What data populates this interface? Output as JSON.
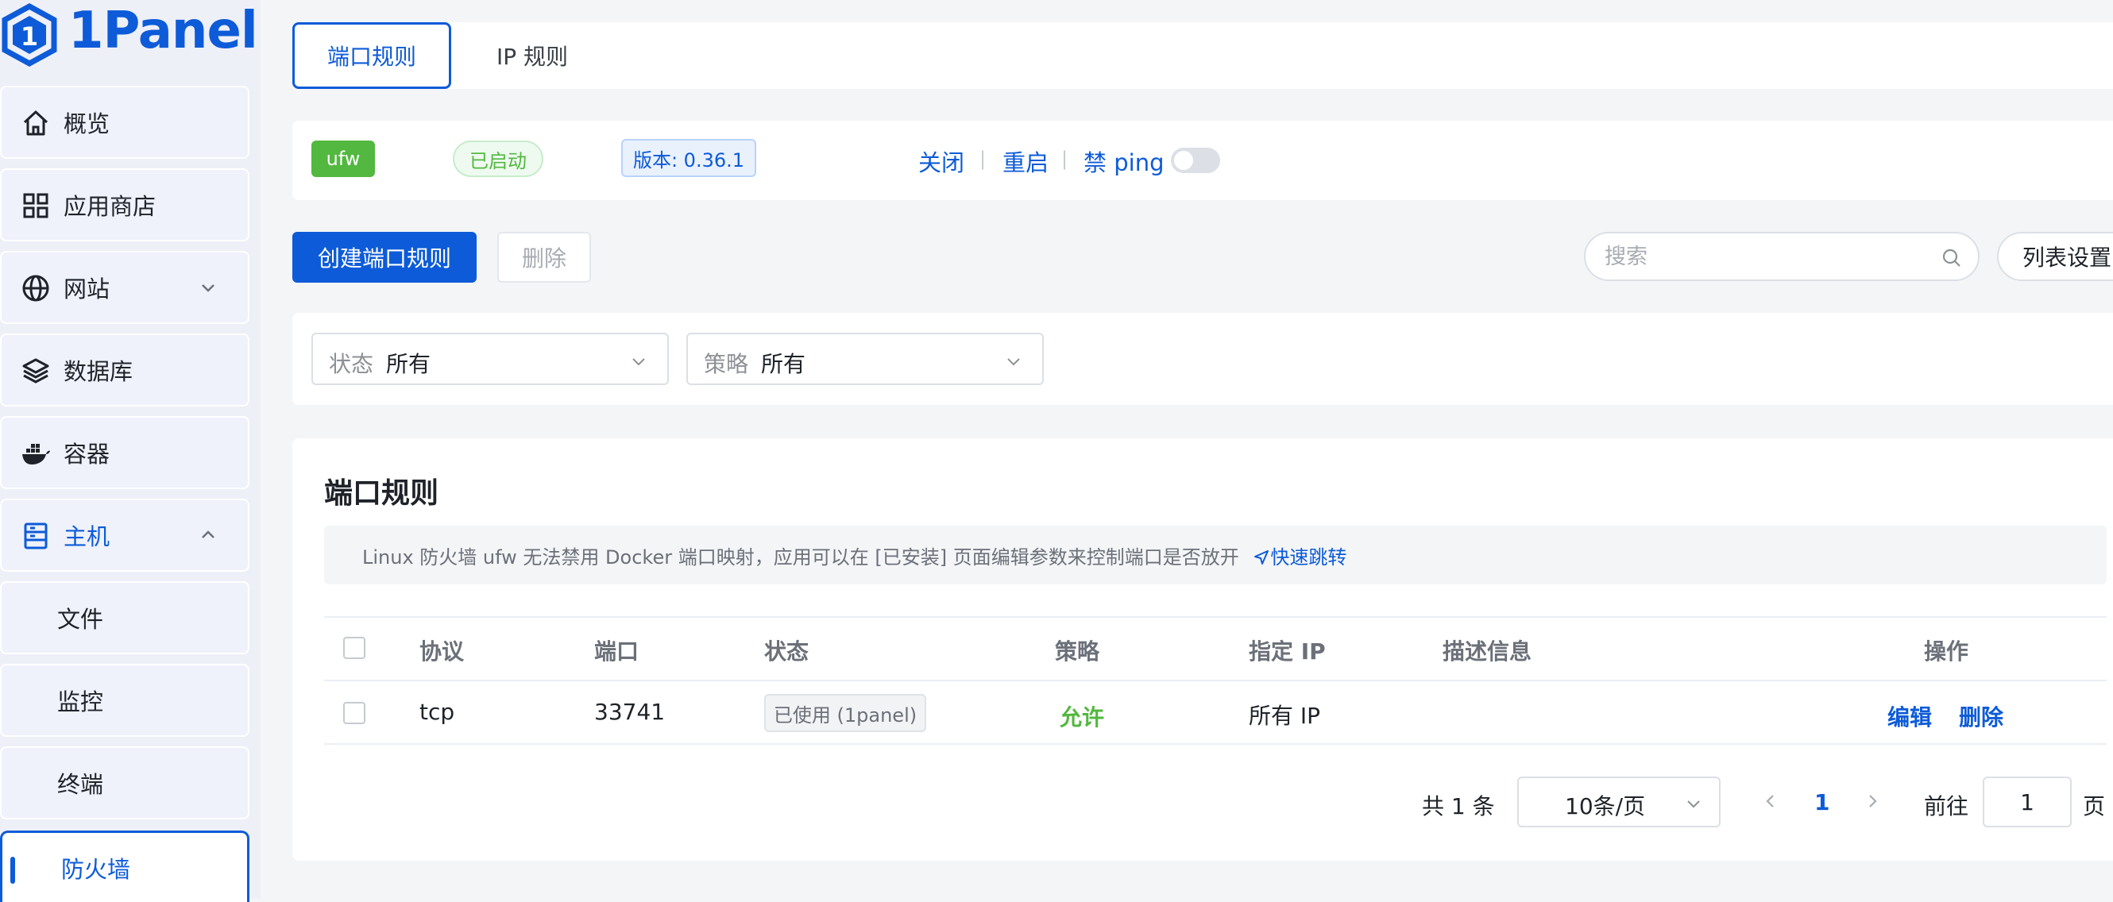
{
  "brand": {
    "name": "1Panel",
    "logo_digit": "1"
  },
  "sidebar": {
    "items": [
      {
        "label": "概览",
        "icon": "home-icon"
      },
      {
        "label": "应用商店",
        "icon": "grid-icon"
      },
      {
        "label": "网站",
        "icon": "globe-icon"
      },
      {
        "label": "数据库",
        "icon": "layers-icon"
      },
      {
        "label": "容器",
        "icon": "docker-icon"
      },
      {
        "label": "主机",
        "icon": "server-icon"
      }
    ],
    "sub_items": [
      {
        "label": "文件"
      },
      {
        "label": "监控"
      },
      {
        "label": "终端"
      },
      {
        "label": "防火墙"
      }
    ]
  },
  "tabs": [
    {
      "label": "端口规则",
      "active": true
    },
    {
      "label": "IP 规则",
      "active": false
    }
  ],
  "status_bar": {
    "engine": "ufw",
    "state": "已启动",
    "version": "版本: 0.36.1",
    "actions": {
      "stop": "关闭",
      "restart": "重启",
      "ban_ping_prefix": "禁",
      "ban_ping_suffix": "ping"
    },
    "ping_banned": false
  },
  "toolbar": {
    "create_label": "创建端口规则",
    "delete_label": "删除",
    "search_placeholder": "搜索",
    "column_settings_label": "列表设置"
  },
  "filters": {
    "status": {
      "prefix": "状态",
      "value": "所有"
    },
    "strategy": {
      "prefix": "策略",
      "value": "所有"
    }
  },
  "section": {
    "title": "端口规则",
    "alert_text": "Linux 防火墙 ufw 无法禁用 Docker 端口映射，应用可以在 [已安装] 页面编辑参数来控制端口是否放开",
    "alert_link": "快速跳转"
  },
  "table": {
    "headers": [
      "协议",
      "端口",
      "状态",
      "策略",
      "指定 IP",
      "描述信息",
      "操作"
    ],
    "rows": [
      {
        "protocol": "tcp",
        "port": "33741",
        "status": "已使用 (1panel)",
        "strategy": "允许",
        "ip": "所有 IP",
        "description": "",
        "edit": "编辑",
        "delete": "删除"
      }
    ]
  },
  "pagination": {
    "total": "共 1 条",
    "page_size": "10条/页",
    "current_page": "1",
    "goto_label": "前往",
    "goto_value": "1",
    "page_suffix": "页"
  },
  "colors": {
    "primary": "#0d5bd8",
    "success": "#52b83f",
    "bg": "#f4f5f7"
  }
}
